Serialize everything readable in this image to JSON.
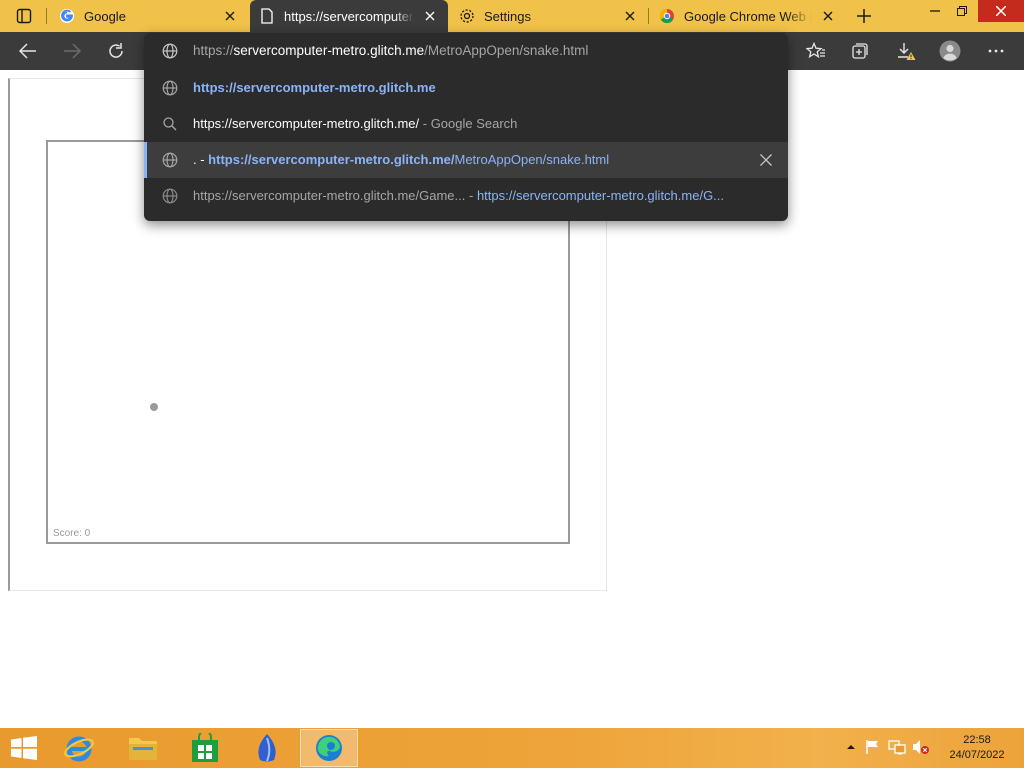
{
  "tabs": [
    {
      "title": "Google",
      "icon": "google-g-icon",
      "active": false
    },
    {
      "title": "https://servercomputer-metro.glitch.me/MetroAppOpen/snake.html",
      "icon": "page-icon",
      "active": true
    },
    {
      "title": "Settings",
      "icon": "gear-icon",
      "active": false
    },
    {
      "title": "Google Chrome Web Browser",
      "icon": "chrome-icon",
      "active": false
    }
  ],
  "omnibox": {
    "input": {
      "prefix": "https://",
      "host": "servercomputer-metro.glitch.me",
      "path": "/MetroAppOpen/snake.html"
    },
    "suggestions": [
      {
        "icon": "globe-icon",
        "text": "https://servercomputer-metro.glitch.me"
      },
      {
        "icon": "search-icon",
        "text": "https://servercomputer-metro.glitch.me/",
        "suffix": " - Google Search"
      },
      {
        "icon": "globe-icon",
        "lead": ". - ",
        "host": "https://servercomputer-metro.glitch.me/",
        "path": "MetroAppOpen/snake.html"
      },
      {
        "icon": "globe-icon",
        "text": "https://servercomputer-metro.glitch.me/Game...",
        "sep": " - ",
        "url": "https://servercomputer-metro.glitch.me/G..."
      }
    ]
  },
  "game": {
    "score_label": "Score: 0"
  },
  "taskbar": {
    "apps": [
      "internet-explorer-icon",
      "file-explorer-icon",
      "store-icon",
      "app-icon",
      "edge-icon"
    ],
    "time": "22:58",
    "date": "24/07/2022"
  },
  "colors": {
    "tabstrip": "#f0c24a",
    "toolbar": "#3b3b3b",
    "omnibox": "#2b2b2b",
    "link": "#8ab4f8",
    "taskbar": "#eda33a"
  }
}
